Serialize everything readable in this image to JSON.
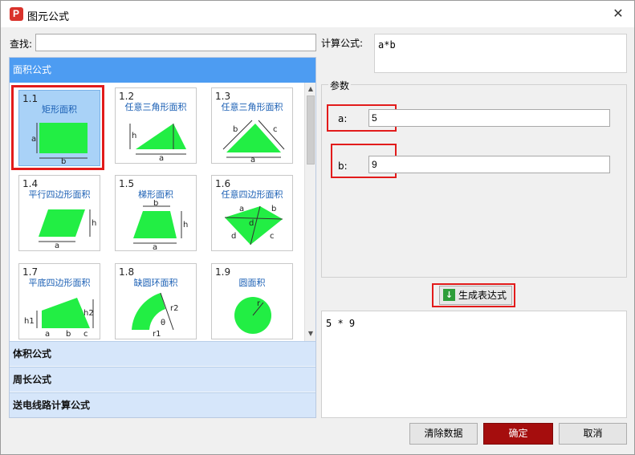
{
  "window": {
    "title": "图元公式",
    "close_glyph": "✕",
    "app_icon_letter": "P"
  },
  "search": {
    "label": "查找:",
    "value": ""
  },
  "left": {
    "active_group": "面积公式",
    "tiles": [
      {
        "num": "1.1",
        "name": "矩形面积"
      },
      {
        "num": "1.2",
        "name": "任意三角形面积"
      },
      {
        "num": "1.3",
        "name": "任意三角形面积"
      },
      {
        "num": "1.4",
        "name": "平行四边形面积"
      },
      {
        "num": "1.5",
        "name": "梯形面积"
      },
      {
        "num": "1.6",
        "name": "任意四边形面积"
      },
      {
        "num": "1.7",
        "name": "平底四边形面积"
      },
      {
        "num": "1.8",
        "name": "缺圆环面积"
      },
      {
        "num": "1.9",
        "name": "圆面积"
      }
    ],
    "groups": [
      "体积公式",
      "周长公式",
      "送电线路计算公式"
    ]
  },
  "calc": {
    "label": "计算公式:",
    "formula": "a*b"
  },
  "params": {
    "title": "参数",
    "a": {
      "label": "a:",
      "value": "5"
    },
    "b": {
      "label": "b:",
      "value": "9"
    }
  },
  "generate_button": "生成表达式",
  "result": "5 * 9",
  "buttons": {
    "clear": "清除数据",
    "ok": "确定",
    "cancel": "取消"
  },
  "colors": {
    "accent": "#4d9cf2",
    "shape_fill": "#22ee44",
    "highlight": "#e21b1b",
    "primary": "#a50d0d"
  }
}
